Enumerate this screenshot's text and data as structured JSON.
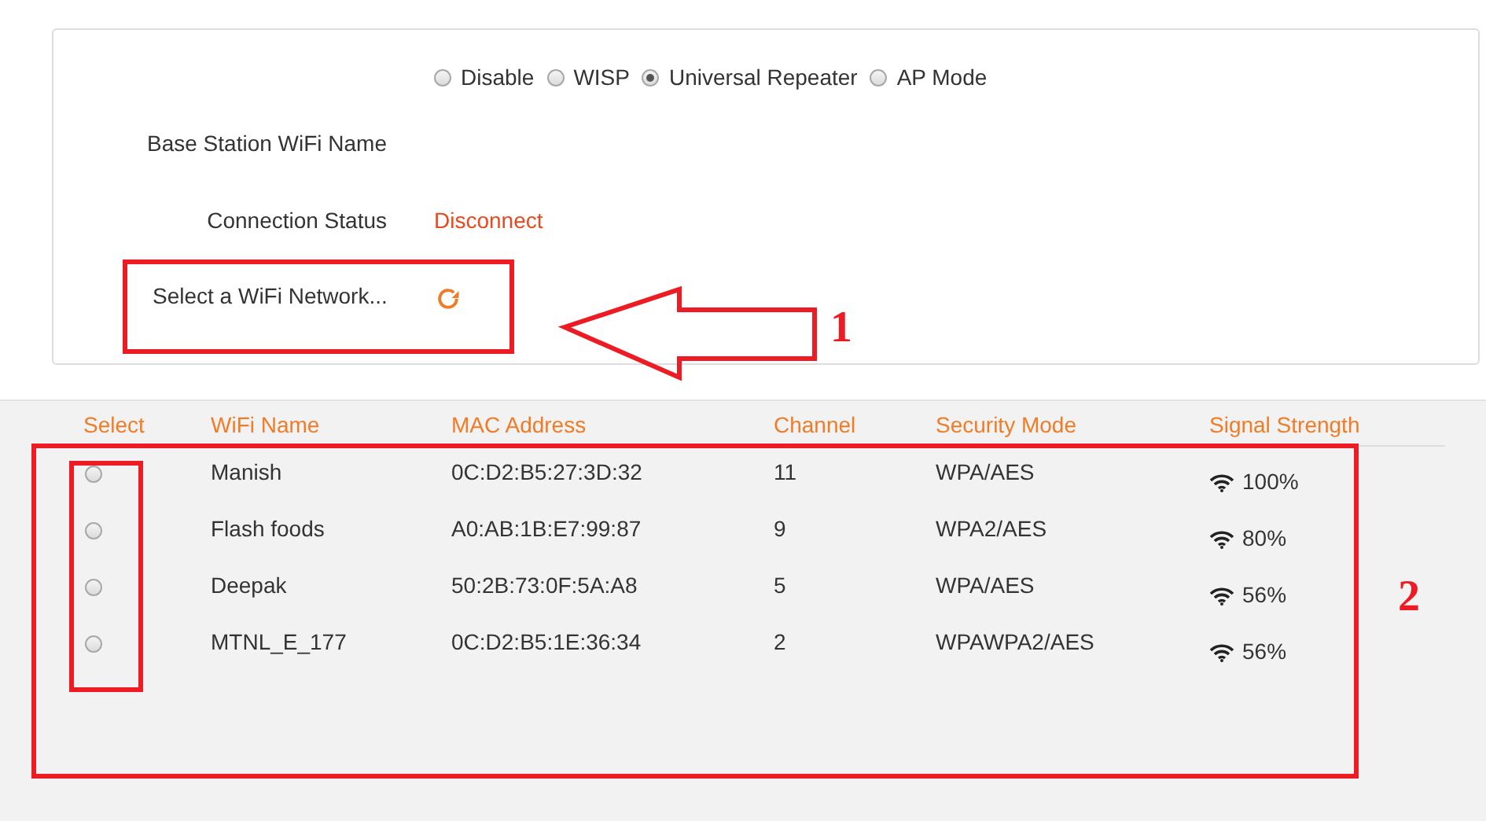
{
  "modes": [
    {
      "label": "Disable",
      "selected": false
    },
    {
      "label": "WISP",
      "selected": false
    },
    {
      "label": "Universal Repeater",
      "selected": true
    },
    {
      "label": "AP Mode",
      "selected": false
    }
  ],
  "fields": [
    {
      "label": "Base Station WiFi Name",
      "kind": "empty"
    },
    {
      "label": "Connection Status",
      "kind": "status",
      "value": "Disconnect"
    },
    {
      "label": "Select a WiFi Network...",
      "kind": "refresh"
    }
  ],
  "table": {
    "columns": [
      "Select",
      "WiFi Name",
      "MAC Address",
      "Channel",
      "Security Mode",
      "Signal Strength"
    ],
    "rows": [
      {
        "selected": false,
        "wifi_name": "Manish",
        "mac_address": "0C:D2:B5:27:3D:32",
        "channel": "11",
        "security_mode": "WPA/AES",
        "signal_strength": "100%"
      },
      {
        "selected": false,
        "wifi_name": "Flash foods",
        "mac_address": "A0:AB:1B:E7:99:87",
        "channel": "9",
        "security_mode": "WPA2/AES",
        "signal_strength": "80%"
      },
      {
        "selected": false,
        "wifi_name": "Deepak",
        "mac_address": "50:2B:73:0F:5A:A8",
        "channel": "5",
        "security_mode": "WPA/AES",
        "signal_strength": "56%"
      },
      {
        "selected": false,
        "wifi_name": "MTNL_E_177",
        "mac_address": "0C:D2:B5:1E:36:34",
        "channel": "2",
        "security_mode": "WPAWPA2/AES",
        "signal_strength": "56%"
      }
    ]
  },
  "annotations": [
    {
      "label": "1"
    },
    {
      "label": "2"
    }
  ]
}
